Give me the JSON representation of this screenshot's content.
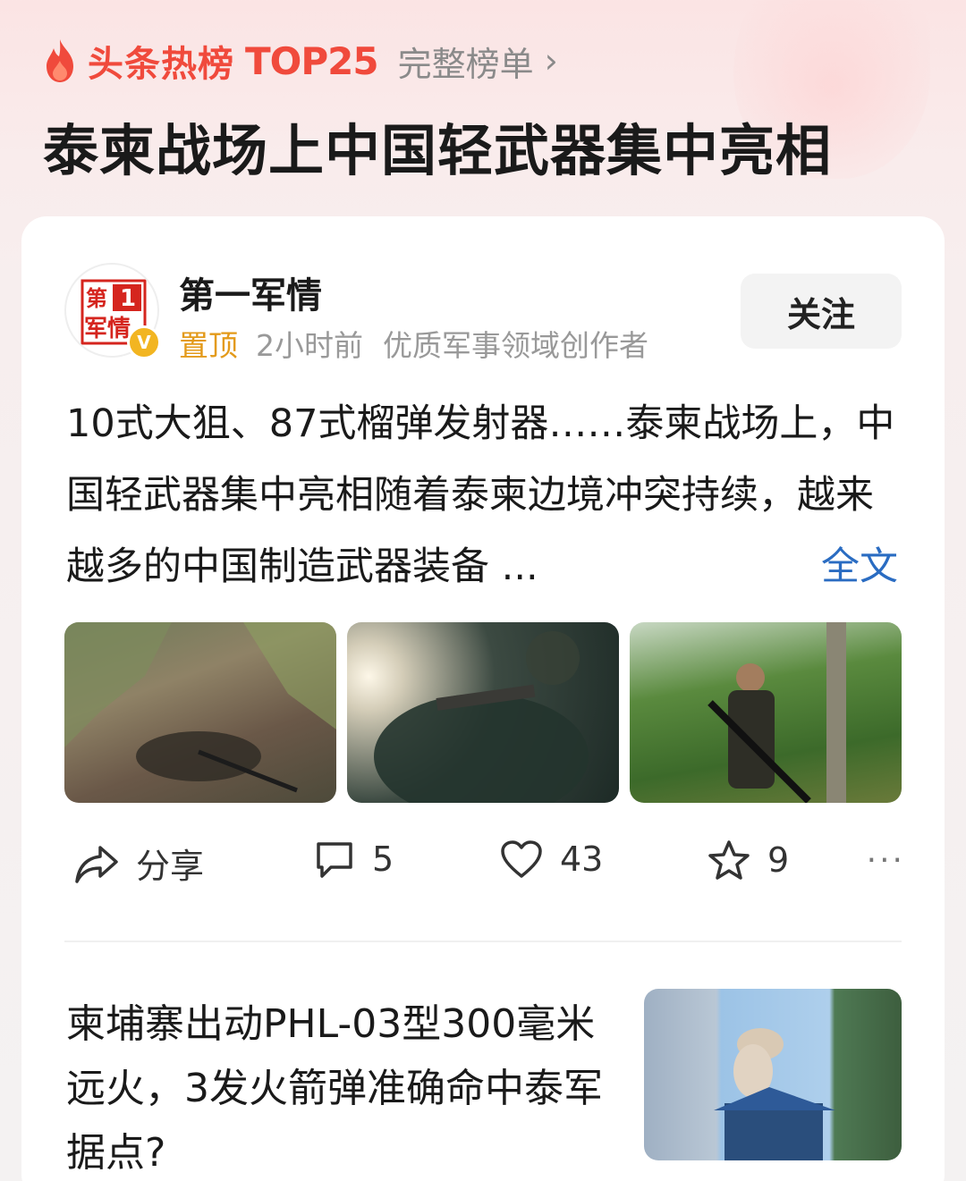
{
  "header": {
    "hot_label": "头条热榜",
    "rank_label": "TOP25",
    "full_list_label": "完整榜单",
    "chevron": "›",
    "headline": "泰柬战场上中国轻武器集中亮相"
  },
  "post": {
    "author": "第一军情",
    "avatar_text_top": "第",
    "avatar_text_num": "1",
    "avatar_text_bottom": "军情",
    "verified_mark": "V",
    "pin_label": "置顶",
    "time": "2小时前",
    "author_desc": "优质军事领域创作者",
    "follow_label": "关注",
    "text": "10式大狙、87式榴弹发射器……泰柬战场上，中国轻武器集中亮相随着泰柬边境冲突持续，越来越多的中国制造武器装备",
    "ellipsis": "...",
    "full_text_link": "全文",
    "actions": {
      "share": "分享",
      "comments": "5",
      "likes": "43",
      "favorites": "9",
      "more": "···"
    }
  },
  "next_item": {
    "title": "柬埔寨出动PHL-03型300毫米远火，3发火箭弹准确命中泰军据点?"
  },
  "colors": {
    "accent": "#f04a3c",
    "pin": "#e39a1a",
    "link": "#2a6cc2",
    "verified": "#f2b521"
  }
}
